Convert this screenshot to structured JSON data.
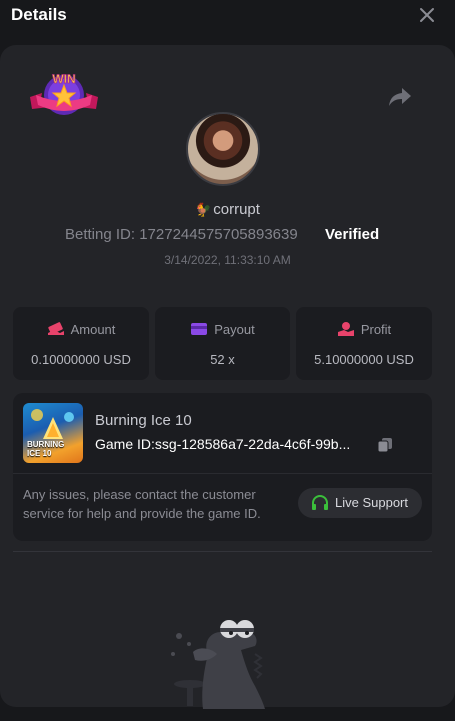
{
  "header": {
    "title": "Details",
    "close_icon": "close-icon"
  },
  "badge": {
    "text": "WIN"
  },
  "user": {
    "name": "corrupt",
    "betting_id_label": "Betting ID: 1727244575705893639",
    "verified_label": "Verified",
    "datetime": "3/14/2022, 11:33:10 AM"
  },
  "stats": [
    {
      "label": "Amount",
      "value": "0.10000000 USD",
      "icon": "amount-icon",
      "color": "#e8436b"
    },
    {
      "label": "Payout",
      "value": "52 x",
      "icon": "payout-icon",
      "color": "#8a49e6"
    },
    {
      "label": "Profit",
      "value": "5.10000000 USD",
      "icon": "profit-icon",
      "color": "#e8436b"
    }
  ],
  "game": {
    "name": "Burning Ice 10",
    "id_text": "Game ID:ssg-128586a7-22da-4c6f-99b...",
    "thumb_text_1": "BURNING",
    "thumb_text_2": "ICE 10"
  },
  "support": {
    "message": "Any issues, please contact the customer service for help and provide the game ID.",
    "button_label": "Live Support"
  },
  "colors": {
    "background": "#17181b",
    "panel": "#232428",
    "card": "#1b1c20",
    "accent_green": "#3bbf3b"
  }
}
